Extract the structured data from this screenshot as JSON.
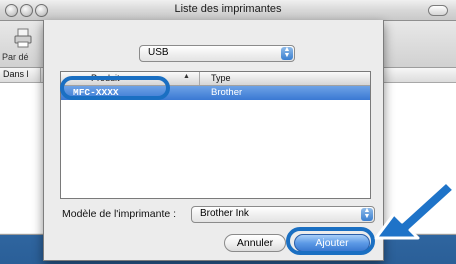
{
  "window": {
    "title": "Liste des imprimantes"
  },
  "toolbar": {
    "button_label": "Par dé"
  },
  "list": {
    "header_label": "Dans l"
  },
  "sheet": {
    "connection_popup": {
      "value": "USB"
    },
    "table": {
      "columns": [
        "Produit",
        "Type"
      ],
      "rows": [
        {
          "name": "MFC-XXXX",
          "type": "Brother"
        }
      ]
    },
    "model": {
      "label": "Modèle de l'imprimante :",
      "value": "Brother Ink"
    },
    "buttons": {
      "cancel": "Annuler",
      "add": "Ajouter"
    }
  },
  "colors": {
    "highlight": "#1a6fc2",
    "selection": "#3a78d3",
    "accent": "#1e73c8"
  }
}
